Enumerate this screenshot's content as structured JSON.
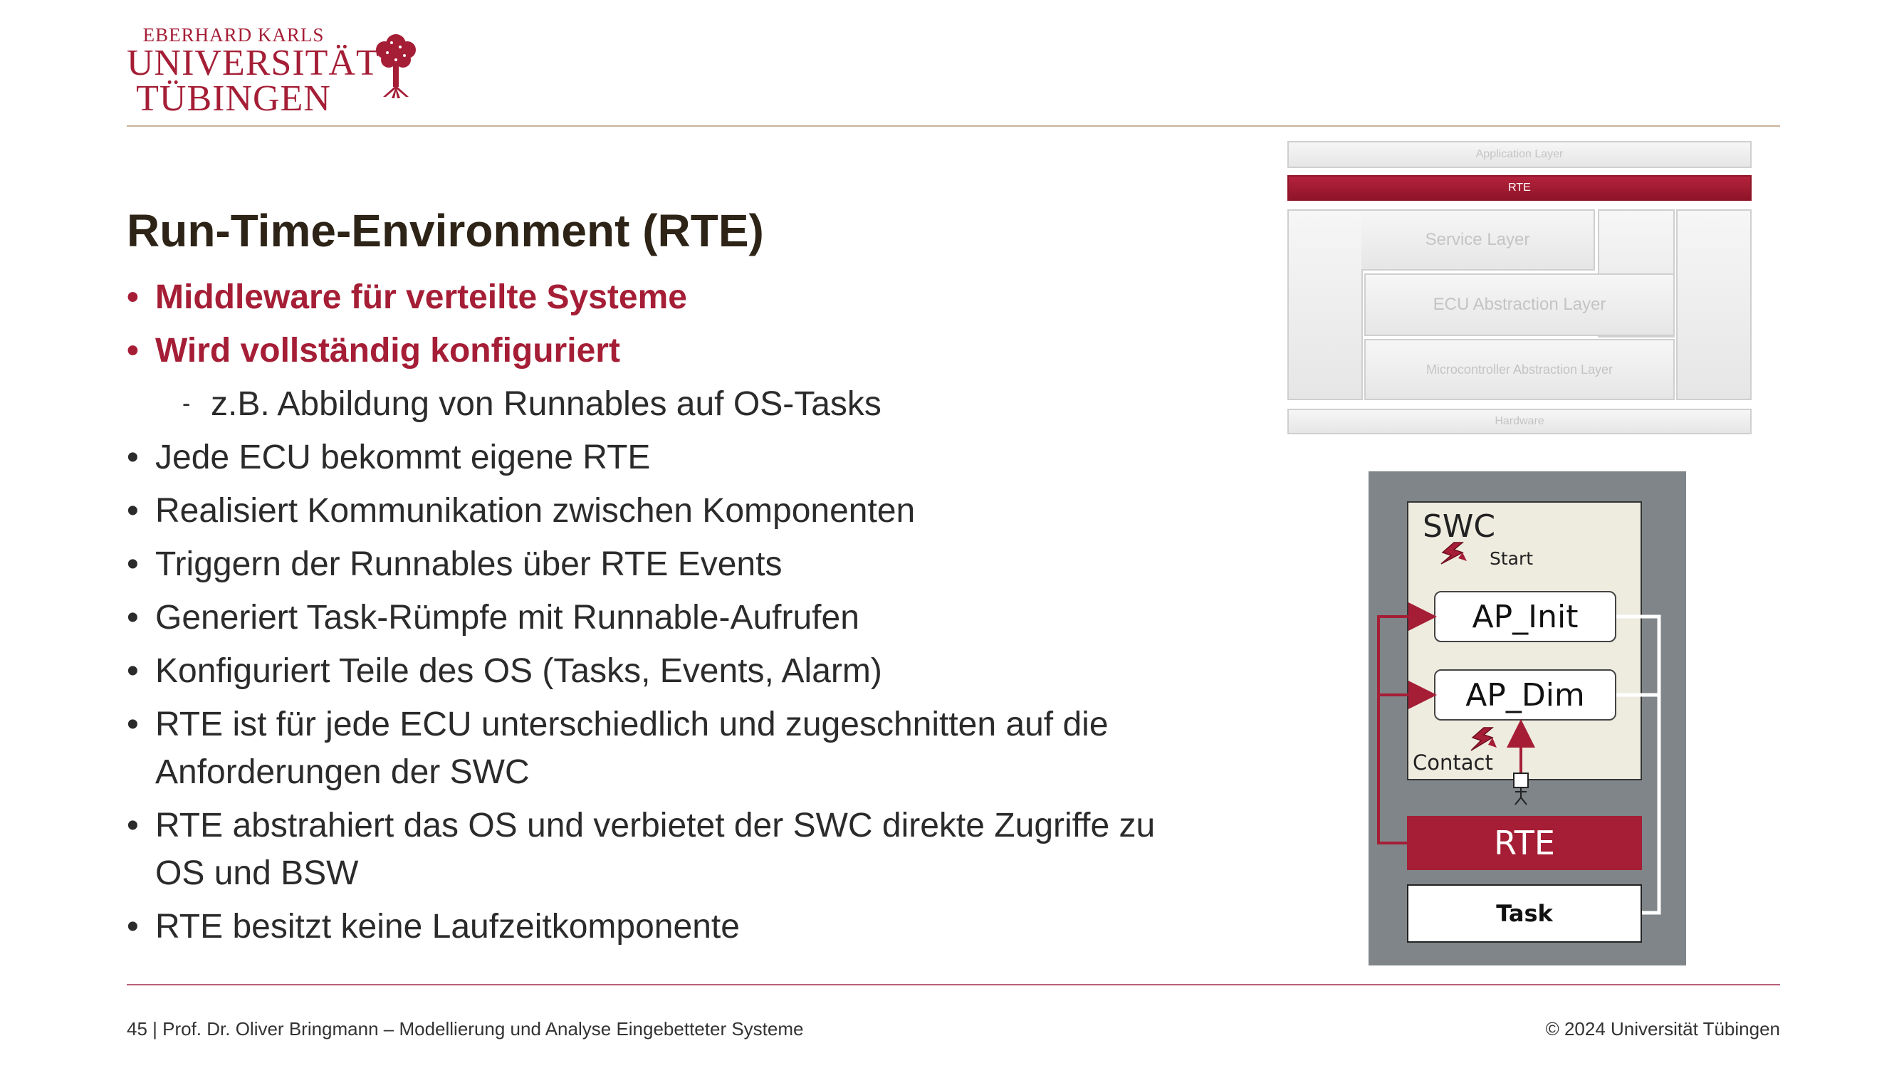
{
  "logo": {
    "line1": "EBERHARD KARLS",
    "line2": "UNIVERSITÄT",
    "line3": "TÜBINGEN"
  },
  "slide": {
    "title": "Run-Time-Environment (RTE)",
    "bullets": [
      {
        "text": "Middleware für verteilte Systeme",
        "style": "accent",
        "marker": "•"
      },
      {
        "text": "Wird vollständig konfiguriert",
        "style": "accent",
        "marker": "•"
      },
      {
        "text": "z.B. Abbildung von Runnables auf OS-Tasks",
        "style": "sub",
        "marker": "-"
      },
      {
        "text": "Jede ECU bekommt eigene RTE",
        "style": "normal",
        "marker": "•"
      },
      {
        "text": "Realisiert Kommunikation zwischen Komponenten",
        "style": "normal",
        "marker": "•"
      },
      {
        "text": "Triggern der Runnables über RTE Events",
        "style": "normal",
        "marker": "•"
      },
      {
        "text": "Generiert Task-Rümpfe mit Runnable-Aufrufen",
        "style": "normal",
        "marker": "•"
      },
      {
        "text": "Konfiguriert Teile des OS (Tasks, Events, Alarm)",
        "style": "normal",
        "marker": "•"
      },
      {
        "text": "RTE ist für jede ECU unterschiedlich und zugeschnitten auf die Anforderungen der SWC",
        "style": "normal",
        "marker": "•"
      },
      {
        "text": "RTE abstrahiert das OS und verbietet der SWC direkte Zugriffe zu OS und BSW",
        "style": "normal",
        "marker": "•"
      },
      {
        "text": "RTE besitzt keine Laufzeitkomponente",
        "style": "normal",
        "marker": "•"
      }
    ]
  },
  "layers": {
    "application": "Application Layer",
    "rte": "RTE",
    "service": "Service Layer",
    "ecu_abstraction": "ECU Abstraction Layer",
    "mcu_abstraction": "Microcontroller Abstraction Layer",
    "hardware": "Hardware"
  },
  "rte_diagram": {
    "swc": "SWC",
    "start": "Start",
    "runnable_init": "AP_Init",
    "runnable_dim": "AP_Dim",
    "contact": "Contact",
    "rte": "RTE",
    "task": "Task"
  },
  "footer": {
    "left": "45 | Prof. Dr. Oliver Bringmann – Modellierung und Analyse Eingebetteter Systeme",
    "right": "© 2024 Universität Tübingen"
  },
  "colors": {
    "accent": "#a51e36",
    "title": "#2d2417",
    "diagram_bg": "#7f8588"
  }
}
